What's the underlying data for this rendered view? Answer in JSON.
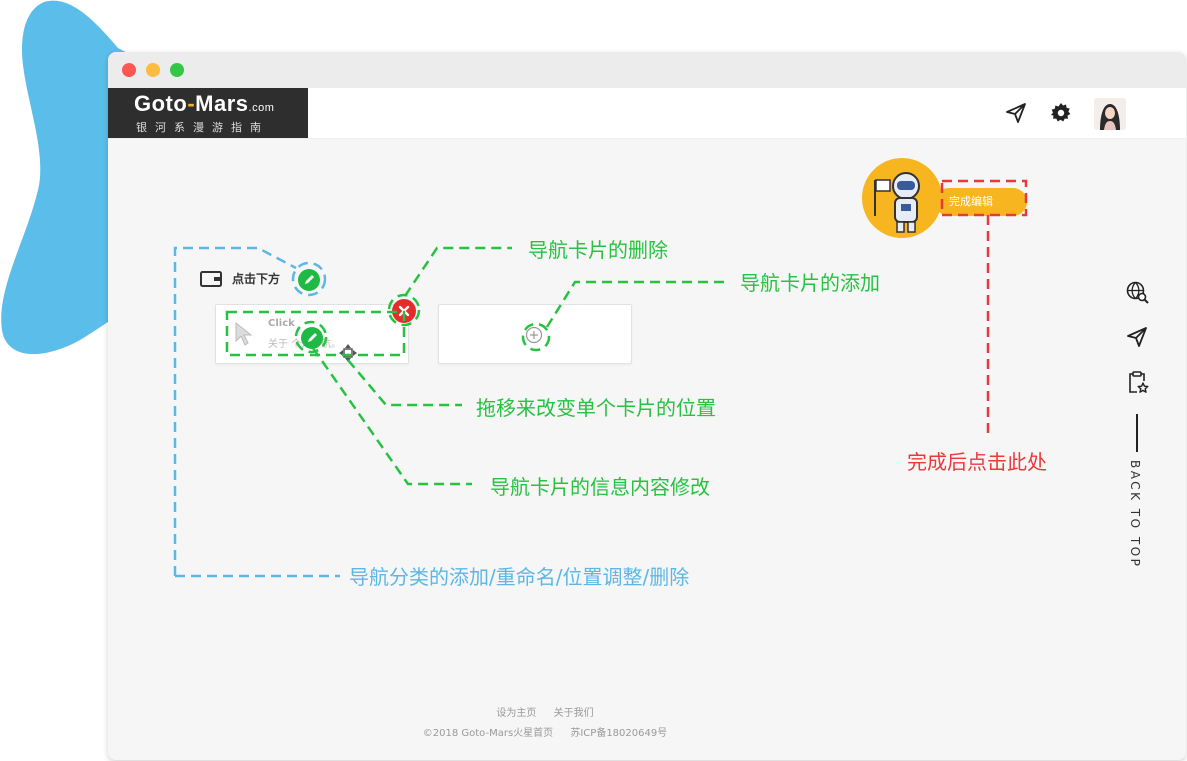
{
  "header": {
    "logo_main_a": "Goto",
    "logo_dash": "-",
    "logo_main_b": "Mars",
    "logo_com": ".com",
    "logo_sub": "银河系漫游指南",
    "icons": [
      "send-icon",
      "gear-icon",
      "avatar"
    ]
  },
  "main": {
    "category_title": "点击下方",
    "card_title": "Click",
    "card_desc": "关于 个人导航。",
    "done_button": "完成编辑"
  },
  "sidebar": {
    "icons": [
      "globe-search-icon",
      "send-icon",
      "clipboard-star-icon"
    ],
    "back_to_top": "BACK TO TOP"
  },
  "footer": {
    "link_home": "设为主页",
    "link_about": "关于我们",
    "copyright": "©2018 Goto-Mars火星首页",
    "icp": "苏ICP备18020649号"
  },
  "annotations": {
    "delete_card": "导航卡片的删除",
    "add_card": "导航卡片的添加",
    "drag_card": "拖移来改变单个卡片的位置",
    "edit_card": "导航卡片的信息内容修改",
    "category_ops": "导航分类的添加/重命名/位置调整/删除",
    "done_hint": "完成后点击此处"
  },
  "colors": {
    "accent_yellow": "#f7b520",
    "annotation_green": "#27c241",
    "annotation_blue": "#5db7e6",
    "annotation_red": "#e83a3a",
    "delete_red": "#e62b2b",
    "edit_green": "#1fba45"
  }
}
